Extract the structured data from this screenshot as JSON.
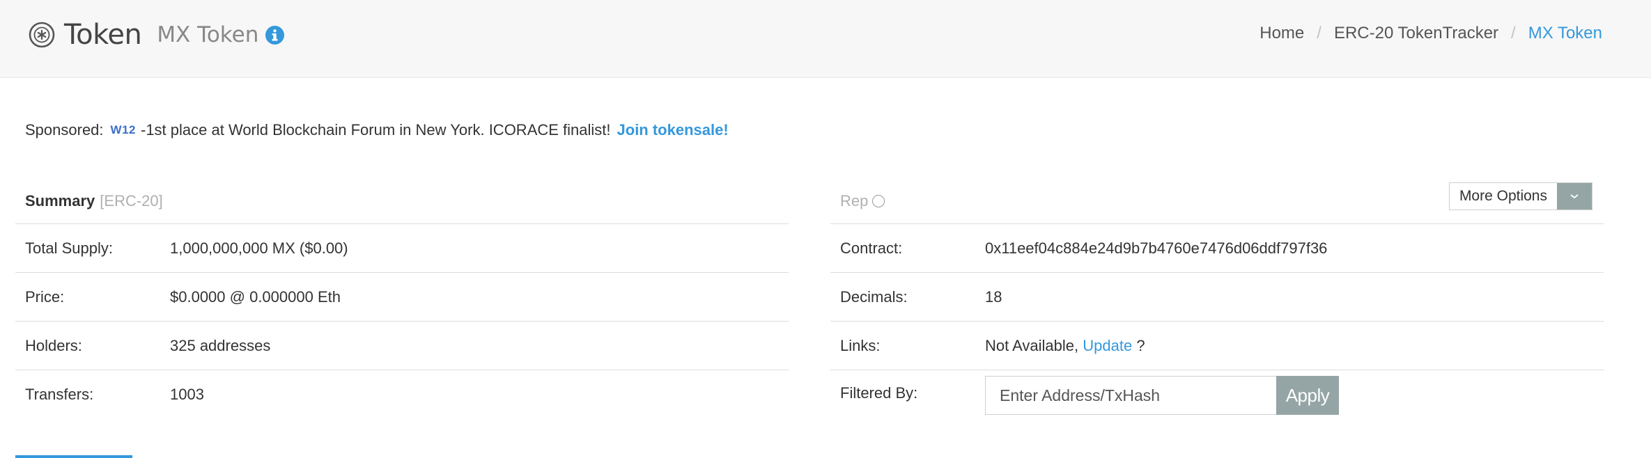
{
  "header": {
    "brand_title": "Token",
    "brand_subtitle": "MX Token",
    "breadcrumb": {
      "home": "Home",
      "section": "ERC-20 TokenTracker",
      "current": "MX Token",
      "sep": "/"
    }
  },
  "sponsored": {
    "label": "Sponsored:",
    "badge": "W12",
    "text": "-1st place at World Blockchain Forum in New York. ICORACE finalist!",
    "link": "Join tokensale!"
  },
  "summary": {
    "title": "Summary",
    "tag": "[ERC-20]",
    "rows": [
      {
        "key": "Total Supply:",
        "value": "1,000,000,000 MX ($0.00)"
      },
      {
        "key": "Price:",
        "value": "$0.0000 @ 0.000000 Eth"
      },
      {
        "key": "Holders:",
        "value": "325 addresses"
      },
      {
        "key": "Transfers:",
        "value": "1003"
      }
    ]
  },
  "details": {
    "rep_label": "Rep",
    "more_options": "More Options",
    "contract_key": "Contract:",
    "contract_value": "0x11eef04c884e24d9b7b4760e7476d06ddf797f36",
    "decimals_key": "Decimals:",
    "decimals_value": "18",
    "links_key": "Links:",
    "links_prefix": "Not Available,",
    "links_update": "Update",
    "links_suffix": "?",
    "filtered_key": "Filtered By:",
    "filter_placeholder": "Enter Address/TxHash",
    "apply_label": "Apply"
  },
  "colors": {
    "link": "#3498db",
    "button": "#95a5a6",
    "muted": "#b0b0b0"
  }
}
